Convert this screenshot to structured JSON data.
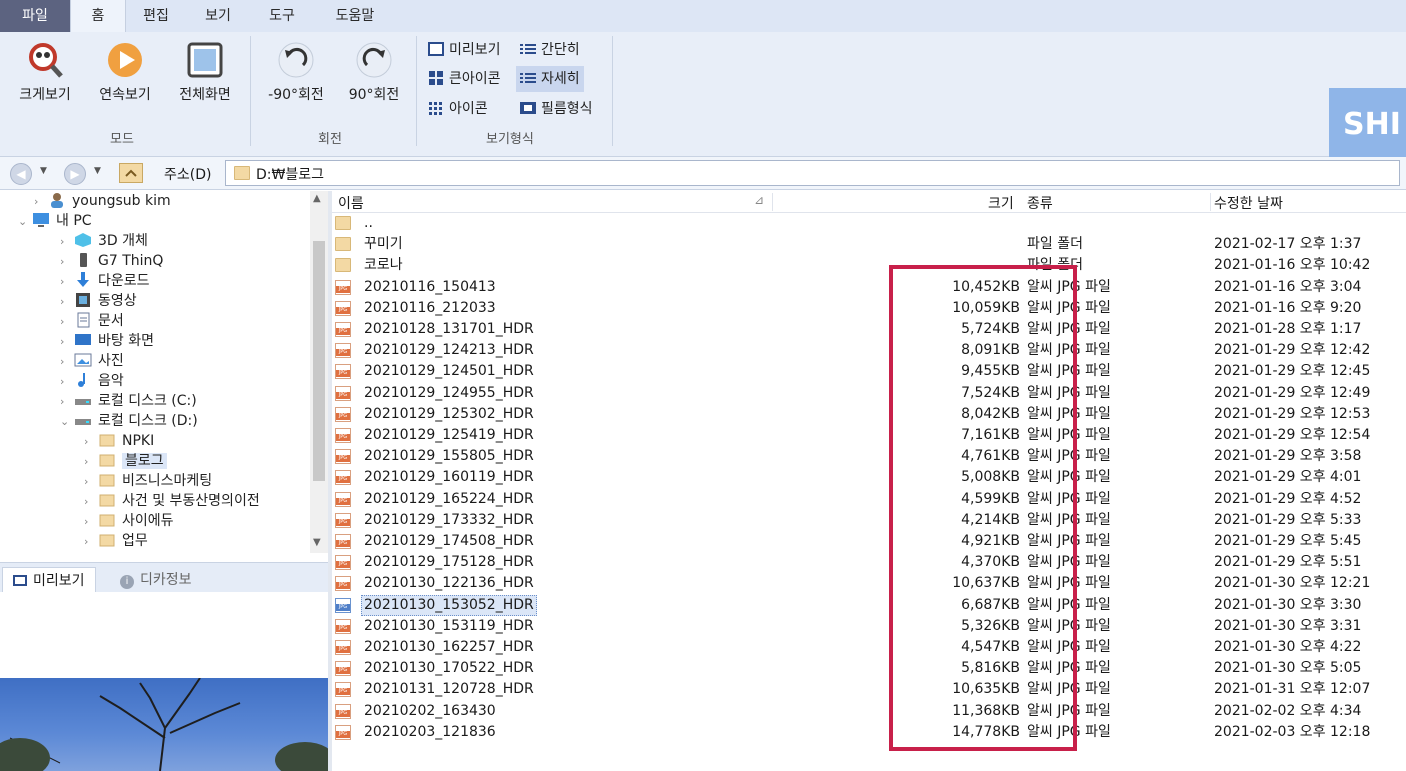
{
  "tabs": [
    "파일",
    "홈",
    "편집",
    "보기",
    "도구",
    "도움말"
  ],
  "ribbon": {
    "mode_buttons": [
      "크게보기",
      "연속보기",
      "전체화면"
    ],
    "mode_group": "모드",
    "rotate_buttons": [
      "-90°회전",
      "90°회전"
    ],
    "rotate_group": "회전",
    "view_options": [
      "미리보기",
      "간단히",
      "큰아이콘",
      "자세히",
      "아이콘",
      "필름형식"
    ],
    "view_group": "보기형식",
    "brand_text": "SHI"
  },
  "address": {
    "label": "주소(D)",
    "path": "D:₩블로그"
  },
  "tree": [
    "youngsub kim",
    "내 PC",
    "3D 개체",
    "G7 ThinQ",
    "다운로드",
    "동영상",
    "문서",
    "바탕 화면",
    "사진",
    "음악",
    "로컬 디스크 (C:)",
    "로컬 디스크 (D:)",
    "NPKI",
    "블로그",
    "비즈니스마케팅",
    "사건 및 부동산명의이전",
    "사이에듀",
    "업무"
  ],
  "preview_tabs": [
    "미리보기",
    "디카정보"
  ],
  "columns": {
    "name": "이름",
    "size": "크기",
    "type": "종류",
    "date": "수정한 날짜"
  },
  "rows": [
    {
      "name": "..",
      "size": "",
      "type": "",
      "date": ""
    },
    {
      "name": "꾸미기",
      "size": "",
      "type": "파일 폴더",
      "date": "2021-02-17 오후 1:37"
    },
    {
      "name": "코로나",
      "size": "",
      "type": "파일 폴더",
      "date": "2021-01-16 오후 10:42"
    },
    {
      "name": "20210116_150413",
      "size": "10,452KB",
      "type": "알씨 JPG 파일",
      "date": "2021-01-16 오후 3:04"
    },
    {
      "name": "20210116_212033",
      "size": "10,059KB",
      "type": "알씨 JPG 파일",
      "date": "2021-01-16 오후 9:20"
    },
    {
      "name": "20210128_131701_HDR",
      "size": "5,724KB",
      "type": "알씨 JPG 파일",
      "date": "2021-01-28 오후 1:17"
    },
    {
      "name": "20210129_124213_HDR",
      "size": "8,091KB",
      "type": "알씨 JPG 파일",
      "date": "2021-01-29 오후 12:42"
    },
    {
      "name": "20210129_124501_HDR",
      "size": "9,455KB",
      "type": "알씨 JPG 파일",
      "date": "2021-01-29 오후 12:45"
    },
    {
      "name": "20210129_124955_HDR",
      "size": "7,524KB",
      "type": "알씨 JPG 파일",
      "date": "2021-01-29 오후 12:49"
    },
    {
      "name": "20210129_125302_HDR",
      "size": "8,042KB",
      "type": "알씨 JPG 파일",
      "date": "2021-01-29 오후 12:53"
    },
    {
      "name": "20210129_125419_HDR",
      "size": "7,161KB",
      "type": "알씨 JPG 파일",
      "date": "2021-01-29 오후 12:54"
    },
    {
      "name": "20210129_155805_HDR",
      "size": "4,761KB",
      "type": "알씨 JPG 파일",
      "date": "2021-01-29 오후 3:58"
    },
    {
      "name": "20210129_160119_HDR",
      "size": "5,008KB",
      "type": "알씨 JPG 파일",
      "date": "2021-01-29 오후 4:01"
    },
    {
      "name": "20210129_165224_HDR",
      "size": "4,599KB",
      "type": "알씨 JPG 파일",
      "date": "2021-01-29 오후 4:52"
    },
    {
      "name": "20210129_173332_HDR",
      "size": "4,214KB",
      "type": "알씨 JPG 파일",
      "date": "2021-01-29 오후 5:33"
    },
    {
      "name": "20210129_174508_HDR",
      "size": "4,921KB",
      "type": "알씨 JPG 파일",
      "date": "2021-01-29 오후 5:45"
    },
    {
      "name": "20210129_175128_HDR",
      "size": "4,370KB",
      "type": "알씨 JPG 파일",
      "date": "2021-01-29 오후 5:51"
    },
    {
      "name": "20210130_122136_HDR",
      "size": "10,637KB",
      "type": "알씨 JPG 파일",
      "date": "2021-01-30 오후 12:21"
    },
    {
      "name": "20210130_153052_HDR",
      "size": "6,687KB",
      "type": "알씨 JPG 파일",
      "date": "2021-01-30 오후 3:30"
    },
    {
      "name": "20210130_153119_HDR",
      "size": "5,326KB",
      "type": "알씨 JPG 파일",
      "date": "2021-01-30 오후 3:31"
    },
    {
      "name": "20210130_162257_HDR",
      "size": "4,547KB",
      "type": "알씨 JPG 파일",
      "date": "2021-01-30 오후 4:22"
    },
    {
      "name": "20210130_170522_HDR",
      "size": "5,816KB",
      "type": "알씨 JPG 파일",
      "date": "2021-01-30 오후 5:05"
    },
    {
      "name": "20210131_120728_HDR",
      "size": "10,635KB",
      "type": "알씨 JPG 파일",
      "date": "2021-01-31 오후 12:07"
    },
    {
      "name": "20210202_163430",
      "size": "11,368KB",
      "type": "알씨 JPG 파일",
      "date": "2021-02-02 오후 4:34"
    },
    {
      "name": "20210203_121836",
      "size": "14,778KB",
      "type": "알씨 JPG 파일",
      "date": "2021-02-03 오후 12:18"
    }
  ],
  "colors": {
    "highlight": "#c8204a",
    "file_tab": "#5c6380",
    "ribbon": "#e8eef8"
  }
}
